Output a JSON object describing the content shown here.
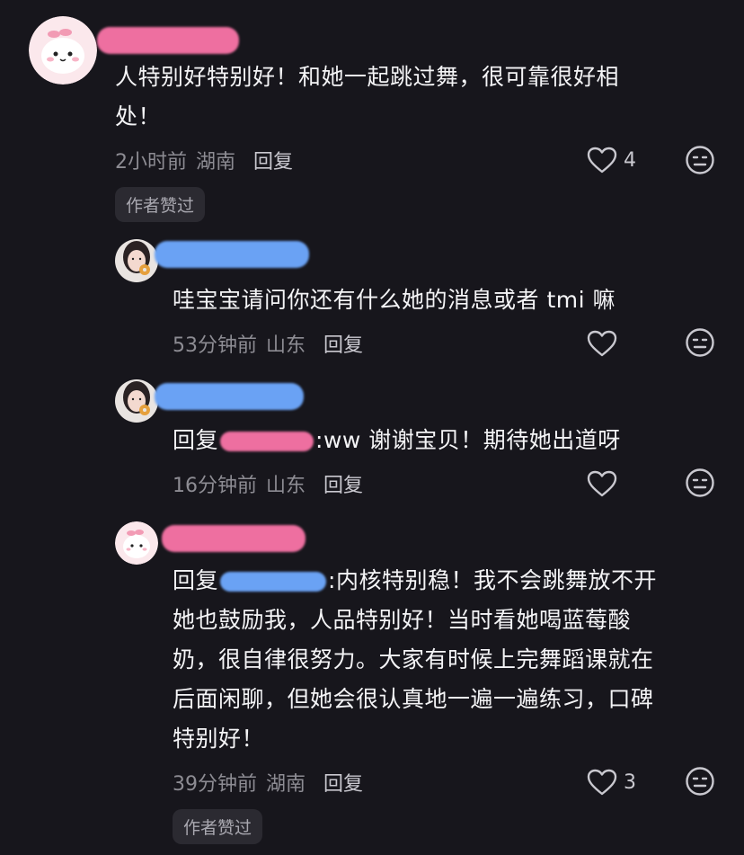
{
  "comments": [
    {
      "text_lines": [
        "人特别好特别好！和她一起跳过舞，很可靠很好相",
        "处！"
      ],
      "time": "2小时前",
      "location": "湖南",
      "reply_label": "回复",
      "like_count": "4",
      "badge": "作者赞过"
    },
    {
      "text_lines": [
        "哇宝宝请问你还有什么她的消息或者 tmi 嘛"
      ],
      "time": "53分钟前",
      "location": "山东",
      "reply_label": "回复"
    },
    {
      "reply_prefix": "回复",
      "text_lines": [
        ":ww 谢谢宝贝！期待她出道呀"
      ],
      "time": "16分钟前",
      "location": "山东",
      "reply_label": "回复"
    },
    {
      "reply_prefix": "回复",
      "text_lines": [
        ":内核特别稳！我不会跳舞放不开",
        "她也鼓励我，人品特别好！当时看她喝蓝莓酸",
        "奶，很自律很努力。大家有时候上完舞蹈课就在",
        "后面闲聊，但她会很认真地一遍一遍练习，口碑",
        "特别好！"
      ],
      "time": "39分钟前",
      "location": "湖南",
      "reply_label": "回复",
      "like_count": "3",
      "badge": "作者赞过"
    }
  ],
  "icons": {
    "like": "heart-outline-icon",
    "dislike": "meh-face-icon"
  },
  "colors": {
    "background": "#17161c",
    "redact_pink": "#ee6fa0",
    "redact_blue": "#6aa2f4"
  }
}
